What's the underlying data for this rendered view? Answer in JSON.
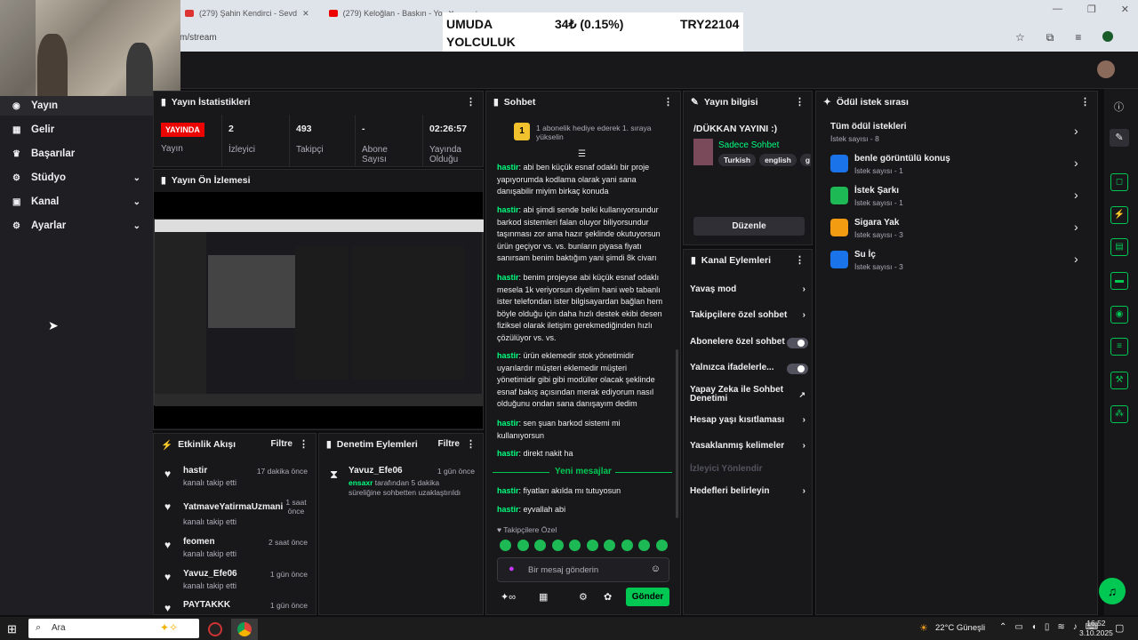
{
  "browser": {
    "tabs": [
      "(279) Şahin Kendirci - Sevd",
      "(279) Keloğlan - Baskın - Yo"
    ],
    "address": "m/stream"
  },
  "ticker": {
    "line1": "UMUDA",
    "line2": "YOLCULUK",
    "price": "34₺ (0.15%)",
    "code": "TRY22104"
  },
  "sidebar": {
    "items": [
      {
        "label": "Yayın"
      },
      {
        "label": "Gelir"
      },
      {
        "label": "Başarılar"
      },
      {
        "label": "Stüdyo"
      },
      {
        "label": "Kanal"
      },
      {
        "label": "Ayarlar"
      }
    ]
  },
  "stats": {
    "title": "Yayın İstatistikleri",
    "live_badge": "YAYINDA",
    "live_label": "Yayın",
    "viewers_value": "2",
    "viewers_label": "İzleyici",
    "followers_value": "493",
    "followers_label": "Takipçi",
    "subs_value": "-",
    "subs_label1": "Abone",
    "subs_label2": "Sayısı",
    "duration_value": "02:26:57",
    "duration_label1": "Yayında",
    "duration_label2": "Olduğu"
  },
  "preview": {
    "title": "Yayın Ön İzlemesi"
  },
  "activity": {
    "title": "Etkinlik Akışı",
    "filter": "Filtre",
    "items": [
      {
        "user": "hastir",
        "action": "kanalı takip etti",
        "time": "17 dakika önce"
      },
      {
        "user": "YatmaveYatirmaUzmani",
        "action": "kanalı takip etti",
        "time": "1 saat önce"
      },
      {
        "user": "feomen",
        "action": "kanalı takip etti",
        "time": "2 saat önce"
      },
      {
        "user": "Yavuz_Efe06",
        "action": "kanalı takip etti",
        "time": "1 gün önce"
      },
      {
        "user": "PAYTAKKK",
        "action": "",
        "time": "1 gün önce"
      }
    ]
  },
  "moderation": {
    "title": "Denetim Eylemleri",
    "filter": "Filtre",
    "user": "Yavuz_Efe06",
    "time": "1 gün önce",
    "by": "ensaxr",
    "text1": "tarafından 5 dakika",
    "text2": "süreliğine sohbetten uzaklaştırıldı"
  },
  "chat": {
    "title": "Sohbet",
    "pinned_num": "1",
    "pinned_text1": "1 abonelik hediye ederek 1. sıraya",
    "pinned_text2": "yükselin",
    "messages": [
      {
        "user": "hastir",
        "lines": [
          "abi ben küçük esnaf odaklı bir proje",
          "yapıyorumda kodlama olarak yani sana",
          "danışabilir miyim birkaç konuda"
        ]
      },
      {
        "user": "hastir",
        "lines": [
          "abi şimdi sende belki kullanıyorsundur",
          "barkod sistemleri falan oluyor biliyorsundur",
          "taşınması zor ama hazır şeklinde okutuyorsun",
          "ürün geçiyor vs. vs. bunların piyasa fiyatı",
          "sanırsam benim baktığım yani şimdi 8k civarı"
        ]
      },
      {
        "user": "hastir",
        "lines": [
          "benim projeyse abi küçük esnaf odaklı",
          "mesela 1k veriyorsun diyelim hani web tabanlı",
          "ister telefondan ister bilgisayardan bağlan hem",
          "böyle olduğu için daha hızlı destek ekibi desen",
          "fiziksel olarak iletişim gerekmediğinden hızlı",
          "çözülüyor vs. vs."
        ]
      },
      {
        "user": "hastir",
        "lines": [
          "ürün eklemedir stok yönetimidir",
          "uyarılardır müşteri eklemedir müşteri",
          "yönetimidir gibi gibi modüller olacak şeklinde",
          "esnaf bakış açısından merak ediyorum nasıl",
          "olduğunu ondan sana danışayım dedim"
        ]
      },
      {
        "user": "hastir",
        "lines": [
          "sen şuan barkod sistemi mi",
          "kullanıyorsun"
        ]
      },
      {
        "user": "hastir",
        "lines": [
          "direkt nakit ha"
        ]
      }
    ],
    "new_messages": "Yeni mesajlar",
    "messages_after": [
      {
        "user": "hastir",
        "lines": [
          "fiyatları akılda mı tutuyosun"
        ]
      },
      {
        "user": "hastir",
        "lines": [
          "eyvallah abi"
        ]
      }
    ],
    "followers_only": "♥ Takipçilere Özel",
    "input_placeholder": "Bir mesaj gönderin",
    "send": "Gönder"
  },
  "stream_info": {
    "title": "Yayın bilgisi",
    "stream_title": "/DÜKKAN YAYINI :)",
    "category": "Sadece Sohbet",
    "tags": [
      "Turkish",
      "english",
      "g"
    ],
    "edit": "Düzenle"
  },
  "channel_actions": {
    "title": "Kanal Eylemleri",
    "items": [
      {
        "label": "Yavaş mod",
        "kind": "chevron"
      },
      {
        "label": "Takipçilere özel sohbet",
        "kind": "chevron"
      },
      {
        "label": "Abonelere özel sohbet",
        "kind": "toggle"
      },
      {
        "label": "Yalnızca ifadelerle...",
        "kind": "toggle"
      },
      {
        "label": "Yapay Zeka ile Sohbet Denetimi",
        "kind": "external"
      },
      {
        "label": "Hesap yaşı kısıtlaması",
        "kind": "chevron"
      },
      {
        "label": "Yasaklanmış kelimeler",
        "kind": "chevron"
      },
      {
        "label": "İzleyici Yönlendir",
        "kind": "disabled"
      },
      {
        "label": "Hedefleri belirleyin",
        "kind": "chevron"
      }
    ]
  },
  "rewards": {
    "title": "Ödül istek sırası",
    "all_title": "Tüm ödül istekleri",
    "all_count": "İstek sayısı - 8",
    "items": [
      {
        "name": "benle görüntülü konuş",
        "count": "İstek sayısı - 1",
        "color": "#1a73e8"
      },
      {
        "name": "İstek Şarkı",
        "count": "İstek sayısı - 1",
        "color": "#1db954"
      },
      {
        "name": "Sigara Yak",
        "count": "İstek sayısı - 3",
        "color": "#f39c12"
      },
      {
        "name": "Su İç",
        "count": "İstek sayısı - 3",
        "color": "#1a73e8"
      }
    ]
  },
  "taskbar": {
    "search": "Ara",
    "weather": "22°C Güneşli",
    "time": "16:52",
    "date": "3.10.2025"
  },
  "colors": {
    "accent": "#00c853",
    "live": "#eb0400",
    "chat_user": "#00ff7f"
  }
}
